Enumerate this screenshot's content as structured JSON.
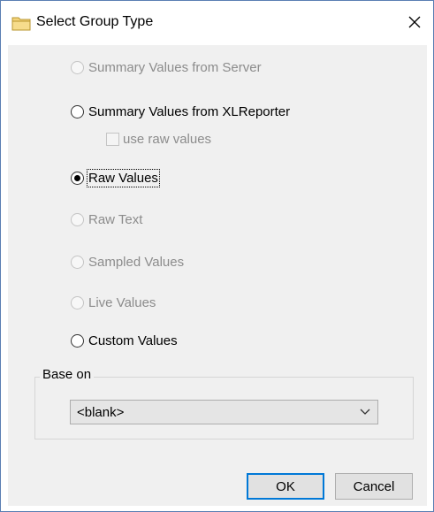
{
  "dialog": {
    "title": "Select Group Type",
    "title_icon": "folder-icon",
    "close_icon": "close-icon"
  },
  "options": [
    {
      "label": "Summary Values from Server",
      "enabled": false,
      "checked": false
    },
    {
      "label": "Summary Values from XLReporter",
      "enabled": true,
      "checked": false
    },
    {
      "label": "Raw Values",
      "enabled": true,
      "checked": true
    },
    {
      "label": "Raw Text",
      "enabled": false,
      "checked": false
    },
    {
      "label": "Sampled Values",
      "enabled": false,
      "checked": false
    },
    {
      "label": "Live Values",
      "enabled": false,
      "checked": false
    },
    {
      "label": "Custom Values",
      "enabled": true,
      "checked": false
    }
  ],
  "use_raw_values": {
    "label": "use raw values",
    "enabled": false,
    "checked": false
  },
  "base_on": {
    "group_label": "Base on",
    "selected": "<blank>",
    "arrow_icon": "chevron-down-icon"
  },
  "buttons": {
    "ok": "OK",
    "cancel": "Cancel"
  },
  "colors": {
    "accent": "#0078d7",
    "window_border": "#5a7fb3",
    "folder": "#f3d37a"
  }
}
